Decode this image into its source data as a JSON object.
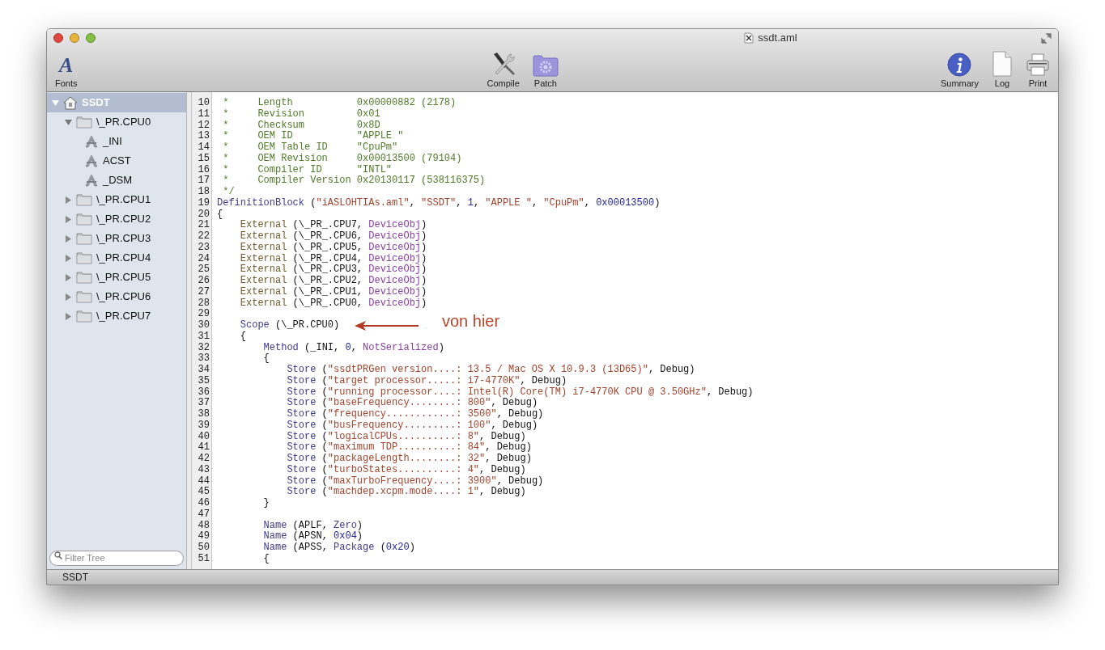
{
  "window": {
    "title": "ssdt.aml"
  },
  "toolbar": {
    "left": [
      {
        "kind": "fonts",
        "label": "Fonts",
        "glyph": "A"
      }
    ],
    "center": [
      {
        "kind": "compile",
        "label": "Compile"
      },
      {
        "kind": "patch",
        "label": "Patch"
      }
    ],
    "right": [
      {
        "kind": "summary",
        "label": "Summary"
      },
      {
        "kind": "log",
        "label": "Log"
      },
      {
        "kind": "print",
        "label": "Print"
      }
    ]
  },
  "sidebar": {
    "tree": [
      {
        "kind": "root",
        "label": "SSDT",
        "expanded": true,
        "selected": true,
        "children": [
          {
            "kind": "folder",
            "label": "\\_PR.CPU0",
            "expanded": true,
            "selected": false,
            "children": [
              {
                "kind": "method",
                "label": "_INI",
                "selected": false
              },
              {
                "kind": "method",
                "label": "ACST",
                "selected": false
              },
              {
                "kind": "method",
                "label": "_DSM",
                "selected": false
              }
            ]
          },
          {
            "kind": "folder",
            "label": "\\_PR.CPU1",
            "expanded": false,
            "selected": false
          },
          {
            "kind": "folder",
            "label": "\\_PR.CPU2",
            "expanded": false,
            "selected": false
          },
          {
            "kind": "folder",
            "label": "\\_PR.CPU3",
            "expanded": false,
            "selected": false
          },
          {
            "kind": "folder",
            "label": "\\_PR.CPU4",
            "expanded": false,
            "selected": false
          },
          {
            "kind": "folder",
            "label": "\\_PR.CPU5",
            "expanded": false,
            "selected": false
          },
          {
            "kind": "folder",
            "label": "\\_PR.CPU6",
            "expanded": false,
            "selected": false
          },
          {
            "kind": "folder",
            "label": "\\_PR.CPU7",
            "expanded": false,
            "selected": false
          }
        ]
      }
    ],
    "filter": {
      "placeholder": "Filter Tree"
    }
  },
  "editor": {
    "lines": [
      {
        "number": "10",
        "tokens": [
          {
            "kind": "comment",
            "text": " *     Length           0x00000882 (2178)"
          }
        ]
      },
      {
        "number": "11",
        "tokens": [
          {
            "kind": "comment",
            "text": " *     Revision         0x01"
          }
        ]
      },
      {
        "number": "12",
        "tokens": [
          {
            "kind": "comment",
            "text": " *     Checksum         0x8D"
          }
        ]
      },
      {
        "number": "13",
        "tokens": [
          {
            "kind": "comment",
            "text": " *     OEM ID           \"APPLE \""
          }
        ]
      },
      {
        "number": "14",
        "tokens": [
          {
            "kind": "comment",
            "text": " *     OEM Table ID     \"CpuPm\""
          }
        ]
      },
      {
        "number": "15",
        "tokens": [
          {
            "kind": "comment",
            "text": " *     OEM Revision     0x00013500 (79104)"
          }
        ]
      },
      {
        "number": "16",
        "tokens": [
          {
            "kind": "comment",
            "text": " *     Compiler ID      \"INTL\""
          }
        ]
      },
      {
        "number": "17",
        "tokens": [
          {
            "kind": "comment",
            "text": " *     Compiler Version 0x20130117 (538116375)"
          }
        ]
      },
      {
        "number": "18",
        "tokens": [
          {
            "kind": "comment",
            "text": " */"
          }
        ]
      },
      {
        "number": "19",
        "tokens": [
          {
            "kind": "keyword",
            "text": "DefinitionBlock"
          },
          {
            "kind": "plain",
            "text": " ("
          },
          {
            "kind": "string",
            "text": "\"iASLOHTIAs.aml\""
          },
          {
            "kind": "plain",
            "text": ", "
          },
          {
            "kind": "string",
            "text": "\"SSDT\""
          },
          {
            "kind": "plain",
            "text": ", "
          },
          {
            "kind": "number",
            "text": "1"
          },
          {
            "kind": "plain",
            "text": ", "
          },
          {
            "kind": "string",
            "text": "\"APPLE \""
          },
          {
            "kind": "plain",
            "text": ", "
          },
          {
            "kind": "string",
            "text": "\"CpuPm\""
          },
          {
            "kind": "plain",
            "text": ", "
          },
          {
            "kind": "number",
            "text": "0x00013500"
          },
          {
            "kind": "plain",
            "text": ")"
          }
        ]
      },
      {
        "number": "20",
        "tokens": [
          {
            "kind": "plain",
            "text": "{"
          }
        ]
      },
      {
        "number": "21",
        "tokens": [
          {
            "kind": "external",
            "text": "    External"
          },
          {
            "kind": "plain",
            "text": " (\\_PR_.CPU7, "
          },
          {
            "kind": "object",
            "text": "DeviceObj"
          },
          {
            "kind": "plain",
            "text": ")"
          }
        ]
      },
      {
        "number": "22",
        "tokens": [
          {
            "kind": "external",
            "text": "    External"
          },
          {
            "kind": "plain",
            "text": " (\\_PR_.CPU6, "
          },
          {
            "kind": "object",
            "text": "DeviceObj"
          },
          {
            "kind": "plain",
            "text": ")"
          }
        ]
      },
      {
        "number": "23",
        "tokens": [
          {
            "kind": "external",
            "text": "    External"
          },
          {
            "kind": "plain",
            "text": " (\\_PR_.CPU5, "
          },
          {
            "kind": "object",
            "text": "DeviceObj"
          },
          {
            "kind": "plain",
            "text": ")"
          }
        ]
      },
      {
        "number": "24",
        "tokens": [
          {
            "kind": "external",
            "text": "    External"
          },
          {
            "kind": "plain",
            "text": " (\\_PR_.CPU4, "
          },
          {
            "kind": "object",
            "text": "DeviceObj"
          },
          {
            "kind": "plain",
            "text": ")"
          }
        ]
      },
      {
        "number": "25",
        "tokens": [
          {
            "kind": "external",
            "text": "    External"
          },
          {
            "kind": "plain",
            "text": " (\\_PR_.CPU3, "
          },
          {
            "kind": "object",
            "text": "DeviceObj"
          },
          {
            "kind": "plain",
            "text": ")"
          }
        ]
      },
      {
        "number": "26",
        "tokens": [
          {
            "kind": "external",
            "text": "    External"
          },
          {
            "kind": "plain",
            "text": " (\\_PR_.CPU2, "
          },
          {
            "kind": "object",
            "text": "DeviceObj"
          },
          {
            "kind": "plain",
            "text": ")"
          }
        ]
      },
      {
        "number": "27",
        "tokens": [
          {
            "kind": "external",
            "text": "    External"
          },
          {
            "kind": "plain",
            "text": " (\\_PR_.CPU1, "
          },
          {
            "kind": "object",
            "text": "DeviceObj"
          },
          {
            "kind": "plain",
            "text": ")"
          }
        ]
      },
      {
        "number": "28",
        "tokens": [
          {
            "kind": "external",
            "text": "    External"
          },
          {
            "kind": "plain",
            "text": " (\\_PR_.CPU0, "
          },
          {
            "kind": "object",
            "text": "DeviceObj"
          },
          {
            "kind": "plain",
            "text": ")"
          }
        ]
      },
      {
        "number": "29"
      },
      {
        "number": "30",
        "annotation": "von hier",
        "tokens": [
          {
            "kind": "keyword",
            "text": "    Scope"
          },
          {
            "kind": "plain",
            "text": " (\\_PR.CPU0)"
          }
        ]
      },
      {
        "number": "31",
        "tokens": [
          {
            "kind": "plain",
            "text": "    {"
          }
        ]
      },
      {
        "number": "32",
        "tokens": [
          {
            "kind": "keyword",
            "text": "        Method"
          },
          {
            "kind": "plain",
            "text": " (_INI, "
          },
          {
            "kind": "number",
            "text": "0"
          },
          {
            "kind": "plain",
            "text": ", "
          },
          {
            "kind": "object",
            "text": "NotSerialized"
          },
          {
            "kind": "plain",
            "text": ")"
          }
        ]
      },
      {
        "number": "33",
        "tokens": [
          {
            "kind": "plain",
            "text": "        {"
          }
        ]
      },
      {
        "number": "34",
        "tokens": [
          {
            "kind": "keyword",
            "text": "            Store"
          },
          {
            "kind": "plain",
            "text": " ("
          },
          {
            "kind": "string",
            "text": "\"ssdtPRGen version....: 13.5 / Mac OS X 10.9.3 (13D65)\""
          },
          {
            "kind": "plain",
            "text": ", Debug)"
          }
        ]
      },
      {
        "number": "35",
        "tokens": [
          {
            "kind": "keyword",
            "text": "            Store"
          },
          {
            "kind": "plain",
            "text": " ("
          },
          {
            "kind": "string",
            "text": "\"target processor.....: i7-4770K\""
          },
          {
            "kind": "plain",
            "text": ", Debug)"
          }
        ]
      },
      {
        "number": "36",
        "tokens": [
          {
            "kind": "keyword",
            "text": "            Store"
          },
          {
            "kind": "plain",
            "text": " ("
          },
          {
            "kind": "string",
            "text": "\"running processor....: Intel(R) Core(TM) i7-4770K CPU @ 3.50GHz\""
          },
          {
            "kind": "plain",
            "text": ", Debug)"
          }
        ]
      },
      {
        "number": "37",
        "tokens": [
          {
            "kind": "keyword",
            "text": "            Store"
          },
          {
            "kind": "plain",
            "text": " ("
          },
          {
            "kind": "string",
            "text": "\"baseFrequency........: 800\""
          },
          {
            "kind": "plain",
            "text": ", Debug)"
          }
        ]
      },
      {
        "number": "38",
        "tokens": [
          {
            "kind": "keyword",
            "text": "            Store"
          },
          {
            "kind": "plain",
            "text": " ("
          },
          {
            "kind": "string",
            "text": "\"frequency............: 3500\""
          },
          {
            "kind": "plain",
            "text": ", Debug)"
          }
        ]
      },
      {
        "number": "39",
        "tokens": [
          {
            "kind": "keyword",
            "text": "            Store"
          },
          {
            "kind": "plain",
            "text": " ("
          },
          {
            "kind": "string",
            "text": "\"busFrequency.........: 100\""
          },
          {
            "kind": "plain",
            "text": ", Debug)"
          }
        ]
      },
      {
        "number": "40",
        "tokens": [
          {
            "kind": "keyword",
            "text": "            Store"
          },
          {
            "kind": "plain",
            "text": " ("
          },
          {
            "kind": "string",
            "text": "\"logicalCPUs..........: 8\""
          },
          {
            "kind": "plain",
            "text": ", Debug)"
          }
        ]
      },
      {
        "number": "41",
        "tokens": [
          {
            "kind": "keyword",
            "text": "            Store"
          },
          {
            "kind": "plain",
            "text": " ("
          },
          {
            "kind": "string",
            "text": "\"maximum TDP..........: 84\""
          },
          {
            "kind": "plain",
            "text": ", Debug)"
          }
        ]
      },
      {
        "number": "42",
        "tokens": [
          {
            "kind": "keyword",
            "text": "            Store"
          },
          {
            "kind": "plain",
            "text": " ("
          },
          {
            "kind": "string",
            "text": "\"packageLength........: 32\""
          },
          {
            "kind": "plain",
            "text": ", Debug)"
          }
        ]
      },
      {
        "number": "43",
        "tokens": [
          {
            "kind": "keyword",
            "text": "            Store"
          },
          {
            "kind": "plain",
            "text": " ("
          },
          {
            "kind": "string",
            "text": "\"turboStates..........: 4\""
          },
          {
            "kind": "plain",
            "text": ", Debug)"
          }
        ]
      },
      {
        "number": "44",
        "tokens": [
          {
            "kind": "keyword",
            "text": "            Store"
          },
          {
            "kind": "plain",
            "text": " ("
          },
          {
            "kind": "string",
            "text": "\"maxTurboFrequency....: 3900\""
          },
          {
            "kind": "plain",
            "text": ", Debug)"
          }
        ]
      },
      {
        "number": "45",
        "tokens": [
          {
            "kind": "keyword",
            "text": "            Store"
          },
          {
            "kind": "plain",
            "text": " ("
          },
          {
            "kind": "string",
            "text": "\"machdep.xcpm.mode....: 1\""
          },
          {
            "kind": "plain",
            "text": ", Debug)"
          }
        ]
      },
      {
        "number": "46",
        "tokens": [
          {
            "kind": "plain",
            "text": "        }"
          }
        ]
      },
      {
        "number": "47"
      },
      {
        "number": "48",
        "tokens": [
          {
            "kind": "keyword",
            "text": "        Name"
          },
          {
            "kind": "plain",
            "text": " (APLF, "
          },
          {
            "kind": "keyword",
            "text": "Zero"
          },
          {
            "kind": "plain",
            "text": ")"
          }
        ]
      },
      {
        "number": "49",
        "tokens": [
          {
            "kind": "keyword",
            "text": "        Name"
          },
          {
            "kind": "plain",
            "text": " (APSN, "
          },
          {
            "kind": "number",
            "text": "0x04"
          },
          {
            "kind": "plain",
            "text": ")"
          }
        ]
      },
      {
        "number": "50",
        "tokens": [
          {
            "kind": "keyword",
            "text": "        Name"
          },
          {
            "kind": "plain",
            "text": " (APSS, "
          },
          {
            "kind": "keyword",
            "text": "Package"
          },
          {
            "kind": "plain",
            "text": " ("
          },
          {
            "kind": "number",
            "text": "0x20"
          },
          {
            "kind": "plain",
            "text": ")"
          }
        ]
      },
      {
        "number": "51",
        "tokens": [
          {
            "kind": "plain",
            "text": "        {"
          }
        ]
      }
    ]
  },
  "status_bar": {
    "text": "SSDT"
  }
}
